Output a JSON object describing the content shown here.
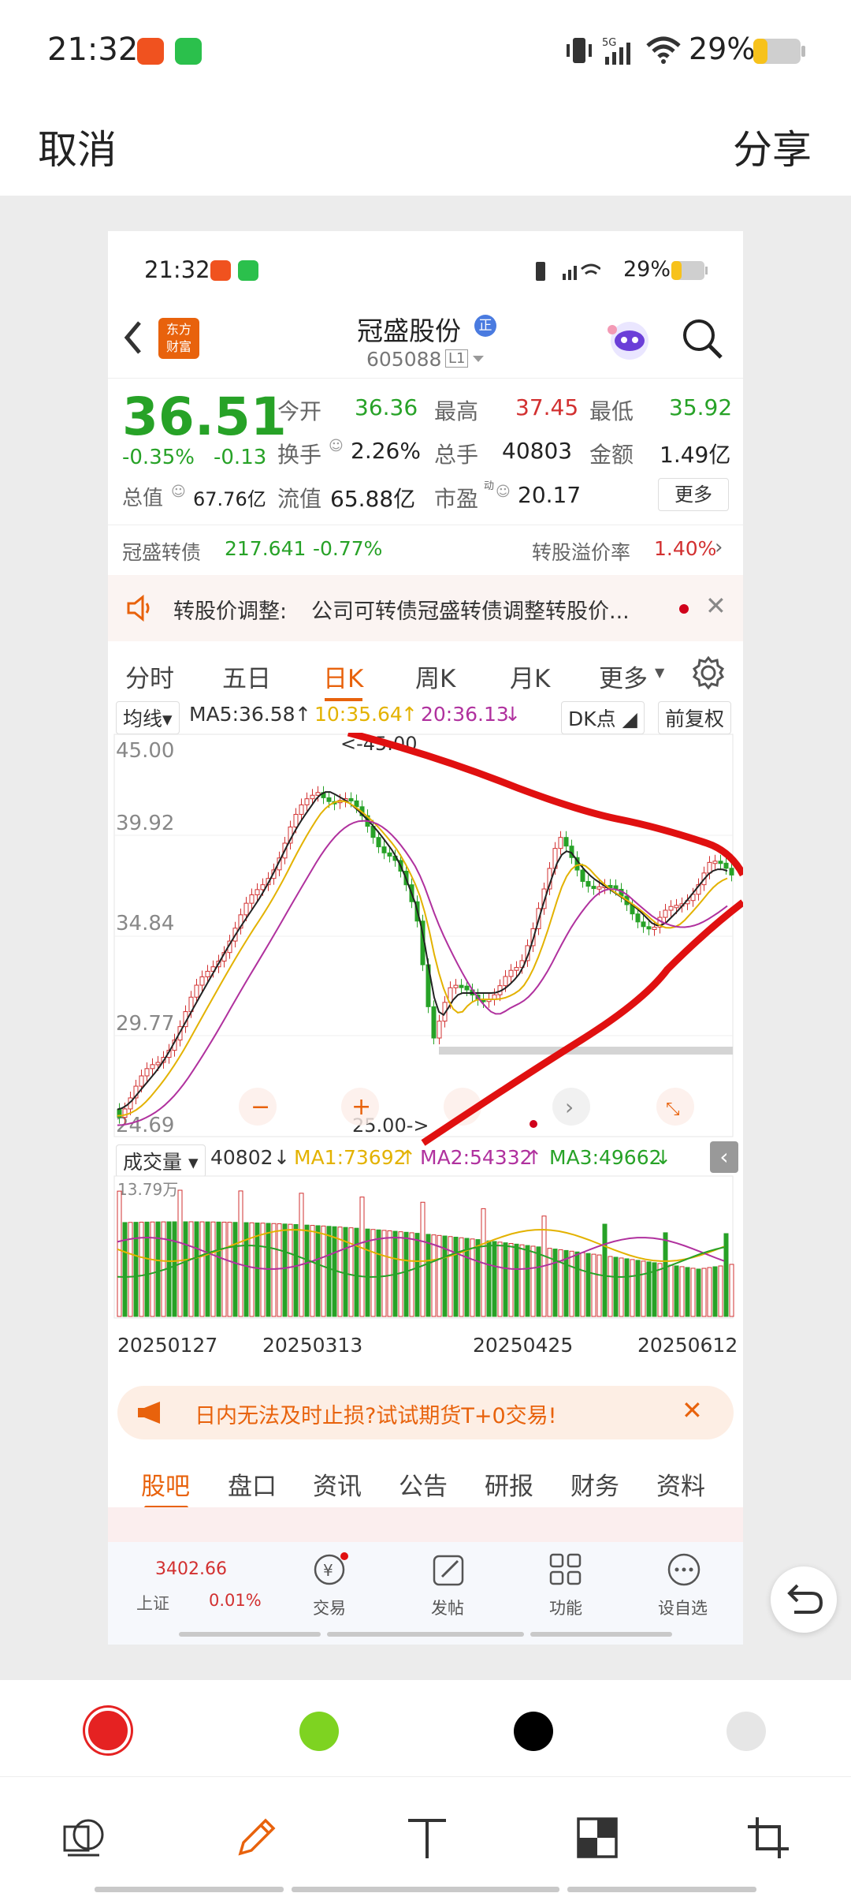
{
  "status_bar": {
    "time": "21:32",
    "battery": "29%",
    "network": "5G"
  },
  "editor": {
    "cancel_label": "取消",
    "share_label": "分享"
  },
  "inner": {
    "status": {
      "time": "21:32",
      "battery": "29%",
      "network": "5G"
    },
    "header": {
      "logo_text": "东方\n财富",
      "stock_name": "冠盛股份",
      "badge": "正",
      "stock_code": "605088",
      "level": "L1"
    },
    "quote": {
      "price": "36.51",
      "change_pct": "-0.35%",
      "change": "-0.13",
      "open_label": "今开",
      "open": "36.36",
      "high_label": "最高",
      "high": "37.45",
      "low_label": "最低",
      "low": "35.92",
      "turnover_label": "换手",
      "turnover": "2.26%",
      "volume_label": "总手",
      "volume": "40803",
      "amount_label": "金额",
      "amount": "1.49亿",
      "total_value_label": "总值",
      "total_value": "67.76亿",
      "float_value_label": "流值",
      "float_value": "65.88亿",
      "pe_label": "市盈",
      "pe_superscript": "动",
      "pe": "20.17",
      "more_label": "更多"
    },
    "bond": {
      "name": "冠盛转债",
      "price": "217.641",
      "change": "-0.77%",
      "premium_label": "转股溢价率",
      "premium": "1.40%"
    },
    "notice": {
      "title": "转股价调整:",
      "text": "公司可转债冠盛转债调整转股价..."
    },
    "chart_tabs": [
      {
        "label": "分时",
        "active": false
      },
      {
        "label": "五日",
        "active": false
      },
      {
        "label": "日K",
        "active": true
      },
      {
        "label": "周K",
        "active": false
      },
      {
        "label": "月K",
        "active": false
      },
      {
        "label": "更多",
        "active": false
      }
    ],
    "indicator_row": {
      "ma_select": "均线",
      "ma5": "MA5:36.58",
      "ma10": "10:35.64",
      "ma20": "20:36.13",
      "dk": "DK点",
      "adjust": "前复权"
    },
    "kline": {
      "y_labels": [
        "45.00",
        "39.92",
        "34.84",
        "29.77",
        "24.69"
      ],
      "high_marker": "<-45.00",
      "low_marker": "25.00->"
    },
    "volume_row": {
      "select": "成交量",
      "vol": "40802",
      "ma1": "MA1:73692",
      "ma2": "MA2:54332",
      "ma3": "MA3:49662",
      "max_label": "13.79万"
    },
    "dates": [
      "20250127",
      "20250313",
      "20250425",
      "20250612"
    ],
    "ad": {
      "text": "日内无法及时止损?试试期货T+0交易!"
    },
    "sub_tabs": [
      {
        "label": "股吧",
        "active": true
      },
      {
        "label": "盘口",
        "active": false
      },
      {
        "label": "资讯",
        "active": false
      },
      {
        "label": "公告",
        "active": false
      },
      {
        "label": "研报",
        "active": false
      },
      {
        "label": "财务",
        "active": false
      },
      {
        "label": "资料",
        "active": false
      }
    ],
    "bottom_nav": {
      "index_value": "3402.66",
      "index_name": "上证",
      "index_change": "0.01%",
      "items": [
        "交易",
        "发帖",
        "功能",
        "设自选"
      ]
    }
  },
  "colors": {
    "up": "#d23030",
    "down": "#27a227",
    "accent": "#e8620c",
    "swatches": [
      "#e52222",
      "#7ed321",
      "#000000",
      "#e6e6e6"
    ]
  },
  "chart_data": {
    "type": "bar",
    "title": "",
    "xlabel": "",
    "ylabel": "",
    "x": [
      "20250127",
      "20250313",
      "20250425",
      "20250612"
    ],
    "ylim": [
      24.69,
      45.0
    ],
    "series": [
      {
        "name": "MA5",
        "values": [
          36.58
        ]
      },
      {
        "name": "MA10",
        "values": [
          35.64
        ]
      },
      {
        "name": "MA20",
        "values": [
          36.13
        ]
      }
    ]
  }
}
